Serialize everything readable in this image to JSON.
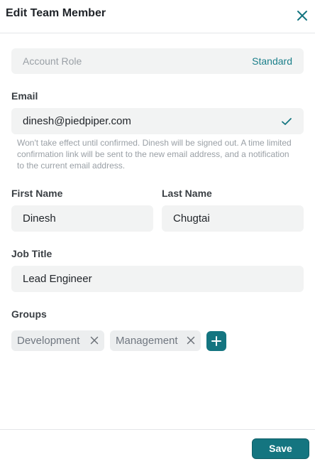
{
  "header": {
    "title": "Edit Team Member"
  },
  "account_role": {
    "label": "Account Role",
    "value": "Standard"
  },
  "email": {
    "label": "Email",
    "value": "dinesh@piedpiper.com",
    "hint": "Won't take effect until confirmed. Dinesh will be signed out. A time limited confirmation link will be sent to the new email address, and a notification to the current email address."
  },
  "first_name": {
    "label": "First Name",
    "value": "Dinesh"
  },
  "last_name": {
    "label": "Last Name",
    "value": "Chugtai"
  },
  "job_title": {
    "label": "Job Title",
    "value": "Lead Engineer"
  },
  "groups": {
    "label": "Groups",
    "items": [
      {
        "label": "Development"
      },
      {
        "label": "Management"
      }
    ]
  },
  "footer": {
    "save_label": "Save"
  },
  "colors": {
    "accent": "#147580",
    "input_bg": "#f2f3f3",
    "chip_bg": "#eceeef"
  },
  "icons": {
    "close": "close-icon",
    "check": "check-icon",
    "chip_remove": "close-icon",
    "add": "plus-icon"
  }
}
